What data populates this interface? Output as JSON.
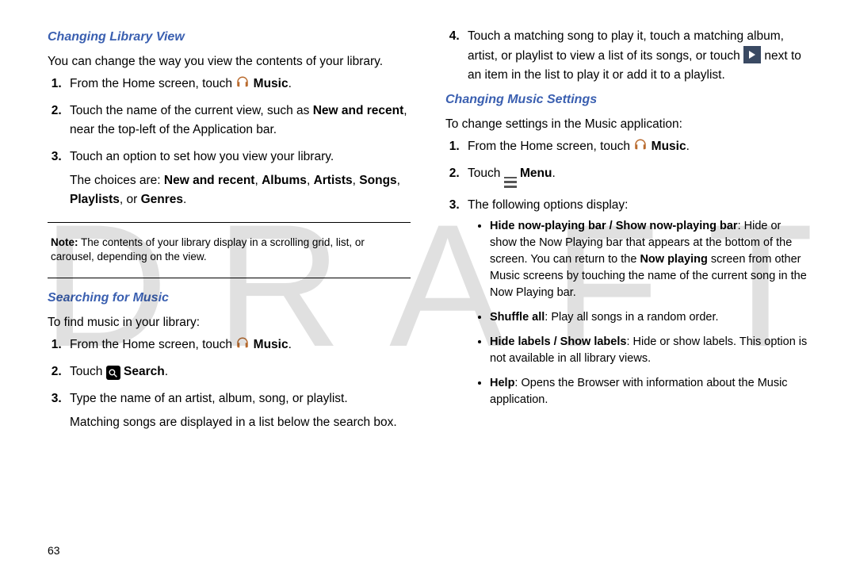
{
  "watermark": "DRAFT",
  "page_number": "63",
  "left": {
    "hd1": "Changing Library View",
    "intro1": "You can change the way you view the contents of your library.",
    "s1_1a": "From the Home screen, touch ",
    "s1_1b": "Music",
    "s1_1c": ".",
    "s1_2a": "Touch the name of the current view, such as ",
    "s1_2b": "New and recent",
    "s1_2c": ", near the top-left of the Application bar.",
    "s1_3": "Touch an option to set how you view your library.",
    "s1_3sub_a": "The choices are: ",
    "s1_3sub_b1": "New and recent",
    "s1_3sub_b2": "Albums",
    "s1_3sub_b3": "Artists",
    "s1_3sub_b4": "Songs",
    "s1_3sub_b5": "Playlists",
    "s1_3sub_b6": "Genres",
    "note_label": "Note:",
    "note_text": " The contents of your library display in a scrolling grid, list, or carousel, depending on the view.",
    "hd2": "Searching for Music",
    "intro2": "To find music in your library:",
    "s2_1a": "From the Home screen, touch ",
    "s2_1b": "Music",
    "s2_1c": ".",
    "s2_2a": "Touch ",
    "s2_2b": "Search",
    "s2_2c": ".",
    "s2_3": "Type the name of an artist, album, song, or playlist.",
    "s2_3sub": "Matching songs are displayed in a list below the search box."
  },
  "right": {
    "s4a": "Touch a matching song to play it, touch a matching album, artist, or playlist to view a list of its songs, or touch ",
    "s4b": " next to an item in the list to play it or add it to a playlist.",
    "hd1": "Changing Music Settings",
    "intro1": "To change settings in the Music application:",
    "r1a": "From the Home screen, touch ",
    "r1b": "Music",
    "r1c": ".",
    "r2a": "Touch ",
    "r2b": "Menu",
    "r2c": ".",
    "r3": "The following options display:",
    "b1h": "Hide now-playing bar / Show now-playing bar",
    "b1a": ": Hide or show the Now Playing bar that appears at the bottom of the screen. You can return to the ",
    "b1b": "Now playing",
    "b1c": " screen from other Music screens by touching the name of the current song in the Now Playing bar.",
    "b2h": "Shuffle all",
    "b2": ": Play all songs in a random order.",
    "b3h": "Hide labels / Show labels",
    "b3": ": Hide or show labels. This option is not available in all library views.",
    "b4h": "Help",
    "b4": ": Opens the Browser with information about the Music application."
  }
}
